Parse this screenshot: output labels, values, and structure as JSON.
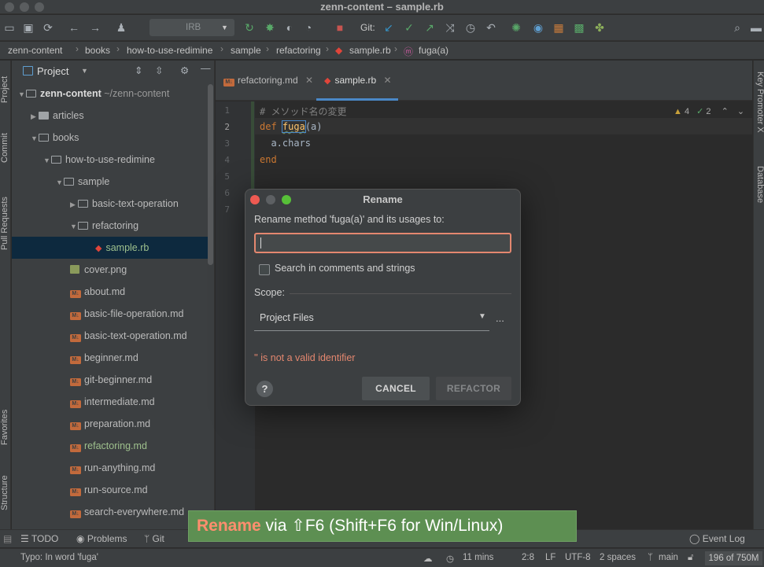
{
  "window": {
    "title": "zenn-content – sample.rb"
  },
  "toolbar": {
    "run_config": "IRB",
    "git_label": "Git:"
  },
  "breadcrumbs": [
    "zenn-content",
    "books",
    "how-to-use-redimine",
    "sample",
    "refactoring",
    "sample.rb",
    "fuga(a)"
  ],
  "left_strip": {
    "project": "Project",
    "commit": "Commit",
    "pull_requests": "Pull Requests",
    "favorites": "Favorites",
    "structure": "Structure"
  },
  "right_strip": {
    "key_promoter": "Key Promoter X",
    "database": "Database"
  },
  "project_panel": {
    "title": "Project",
    "tree": [
      {
        "label": "zenn-content",
        "suffix": " ~/zenn-content"
      },
      {
        "label": "articles"
      },
      {
        "label": "books"
      },
      {
        "label": "how-to-use-redimine"
      },
      {
        "label": "sample"
      },
      {
        "label": "basic-text-operation"
      },
      {
        "label": "refactoring"
      },
      {
        "label": "sample.rb"
      },
      {
        "label": "cover.png"
      },
      {
        "label": "about.md"
      },
      {
        "label": "basic-file-operation.md"
      },
      {
        "label": "basic-text-operation.md"
      },
      {
        "label": "beginner.md"
      },
      {
        "label": "git-beginner.md"
      },
      {
        "label": "intermediate.md"
      },
      {
        "label": "preparation.md"
      },
      {
        "label": "refactoring.md"
      },
      {
        "label": "run-anything.md"
      },
      {
        "label": "run-source.md"
      },
      {
        "label": "search-everywhere.md"
      }
    ]
  },
  "editor": {
    "tabs": [
      {
        "label": "refactoring.md"
      },
      {
        "label": "sample.rb"
      }
    ],
    "line_numbers": [
      "1",
      "2",
      "3",
      "4",
      "5",
      "6",
      "7"
    ],
    "code": {
      "line1": "# メソッド名の変更",
      "line2_kw": "def",
      "line2_name": "fuga",
      "line2_rest": "(a)",
      "line3": "  a.chars",
      "line4": "end"
    },
    "inspections": {
      "warnings": "4",
      "typos": "2"
    }
  },
  "dialog": {
    "title": "Rename",
    "label": "Rename method 'fuga(a)' and its usages to:",
    "input_value": "",
    "checkbox_label": "Search in comments and strings",
    "checkbox_checked": false,
    "scope_label": "Scope:",
    "scope_value": "Project Files",
    "more": "...",
    "error": "'' is not a valid identifier",
    "help": "?",
    "cancel": "CANCEL",
    "refactor": "REFACTOR"
  },
  "tool_windows": {
    "todo": "TODO",
    "problems": "Problems",
    "git": "Git",
    "event_log": "Event Log"
  },
  "status": {
    "message": "Typo: In word 'fuga'",
    "time": "11 mins",
    "position": "2:8",
    "line_sep": "LF",
    "encoding": "UTF-8",
    "indent": "2 spaces",
    "branch": "main",
    "memory": "196 of 750M"
  },
  "key_promoter": {
    "action": "Rename",
    "rest": " via ⇧F6 (Shift+F6 for Win/Linux)"
  },
  "colors": {
    "accent": "#4a88c7",
    "error": "#e4876f",
    "promoter_bg": "#5d8f52",
    "ruby": "#e0453a"
  }
}
